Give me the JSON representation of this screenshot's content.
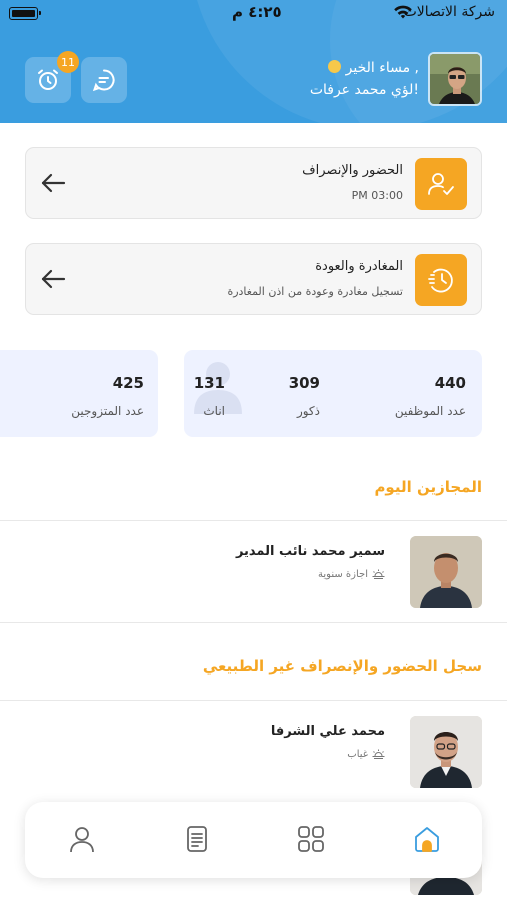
{
  "status_bar": {
    "carrier": "شركة الاتصالات",
    "time": "٤:٢٥ م"
  },
  "header": {
    "greeting": "مساء الخير ,",
    "user_name": "لؤي محمد عرفات!",
    "notification_count": "11",
    "background_color": "#3a9ddf"
  },
  "action_cards": [
    {
      "title": "الحضور والإنصراف",
      "subtitle": "PM 03:00",
      "icon": "user-check-icon"
    },
    {
      "title": "المغادرة والعودة",
      "subtitle": "تسجيل مغادرة وعودة من اذن المغادرة",
      "icon": "clock-history-icon"
    }
  ],
  "stats": {
    "employees": {
      "value": "440",
      "label": "عدد الموظفين"
    },
    "males": {
      "value": "309",
      "label": "ذكور"
    },
    "females": {
      "value": "131",
      "label": "اناث"
    },
    "married": {
      "value": "425",
      "label": "عدد المتزوجين"
    }
  },
  "sections": {
    "on_leave_today": {
      "title": "المجازين اليوم",
      "people": [
        {
          "name": "سمير محمد نائب المدير",
          "status": "اجازة سنوية"
        }
      ]
    },
    "abnormal_attendance": {
      "title": "سجل الحضور والإنصراف غير الطبيعي",
      "people": [
        {
          "name": "محمد علي الشرفا",
          "status": "غياب"
        }
      ]
    }
  },
  "bottom_nav": {
    "items": [
      "home-icon",
      "grid-icon",
      "document-icon",
      "profile-icon"
    ],
    "active": "home-icon"
  },
  "colors": {
    "accent": "#f5a623",
    "primary": "#3a9ddf",
    "stats_bg": "#eef2ff"
  }
}
